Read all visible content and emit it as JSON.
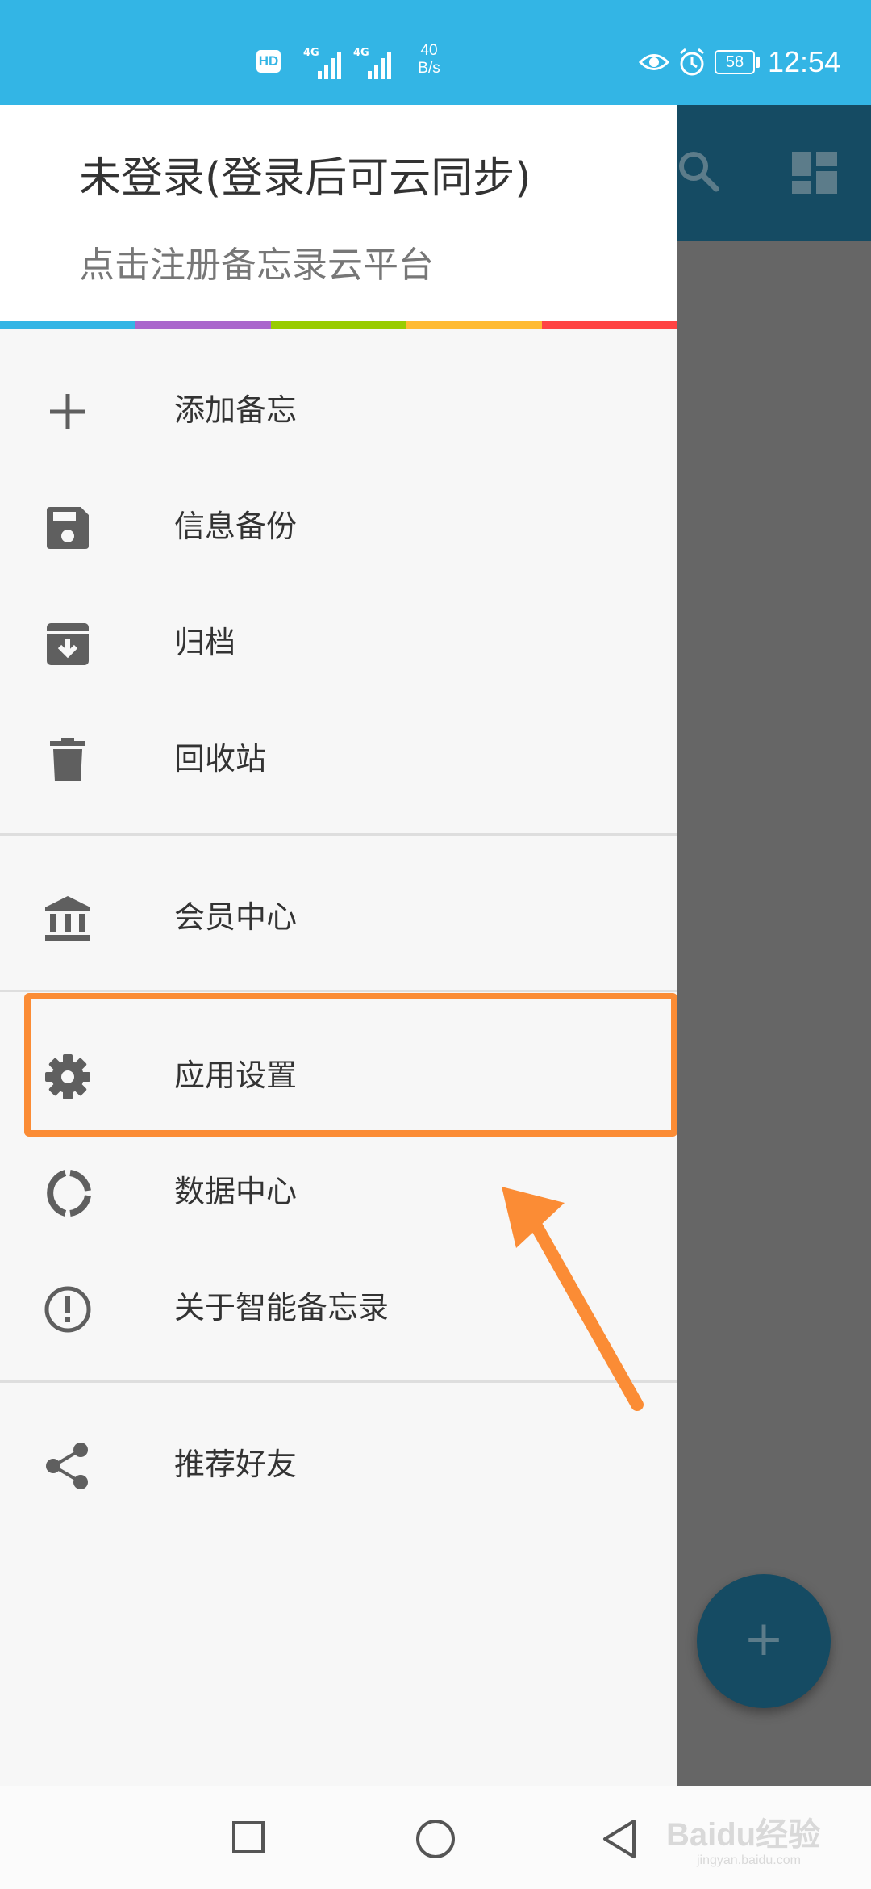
{
  "status_bar": {
    "hd": "HD",
    "sim1_label": "4G",
    "sim2_label": "4G",
    "speed_value": "40",
    "speed_unit": "B/s",
    "battery": "58",
    "time": "12:54",
    "icons": [
      "eye-icon",
      "alarm-icon",
      "battery-icon"
    ],
    "color": "#33b5e5"
  },
  "drawer": {
    "header": {
      "title": "未登录(登录后可云同步)",
      "subtitle": "点击注册备忘录云平台"
    },
    "color_strip": [
      "#33b5e5",
      "#aa66cc",
      "#99cc00",
      "#ffbb33",
      "#ff4444"
    ],
    "items": [
      {
        "label": "添加备忘",
        "icon": "plus-icon"
      },
      {
        "label": "信息备份",
        "icon": "save-icon"
      },
      {
        "label": "归档",
        "icon": "archive-icon"
      },
      {
        "label": "回收站",
        "icon": "trash-icon"
      },
      {
        "label": "会员中心",
        "icon": "bank-icon"
      },
      {
        "label": "应用设置",
        "icon": "gear-icon"
      },
      {
        "label": "数据中心",
        "icon": "donut-chart-icon"
      },
      {
        "label": "关于智能备忘录",
        "icon": "info-icon"
      },
      {
        "label": "推荐好友",
        "icon": "share-icon"
      }
    ]
  },
  "main": {
    "toolbar_color": "#154b63",
    "fab_label": "+",
    "icons": [
      "search-icon",
      "dashboard-icon"
    ]
  },
  "annotation": {
    "highlight_color": "#fb8c35",
    "highlight_target": "应用设置"
  },
  "navbar": {
    "watermark": "Baidu经验",
    "watermark_sub": "jingyan.baidu.com"
  }
}
